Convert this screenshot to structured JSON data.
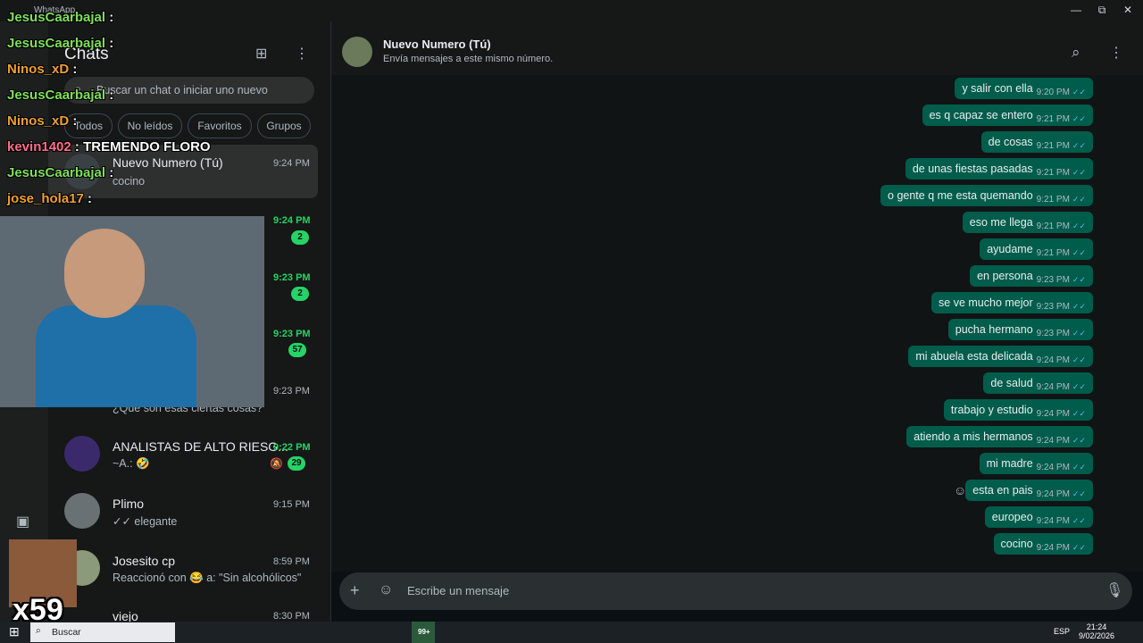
{
  "window": {
    "app_title": "WhatsApp",
    "minimize": "—",
    "restore": "⧉",
    "close": "✕"
  },
  "sidebar": {
    "title": "Chats",
    "search_placeholder": "Buscar un chat o iniciar uno nuevo",
    "filters": [
      "Todos",
      "No leídos",
      "Favoritos",
      "Grupos"
    ],
    "chats": [
      {
        "name": "Nuevo Numero (Tú)",
        "preview": "cocino",
        "time": "9:24 PM",
        "selected": true
      },
      {
        "name": "",
        "preview": "",
        "time": "9:24 PM",
        "badge": "2"
      },
      {
        "name": "",
        "preview": "",
        "time": "9:23 PM",
        "badge": "2"
      },
      {
        "name": "",
        "preview": "",
        "time": "9:23 PM",
        "badge": "57"
      },
      {
        "name": "",
        "preview": "¿Qué son esas ciertas cosas?",
        "time": "9:23 PM"
      },
      {
        "name": "ANALISTAS DE ALTO RIESG...",
        "preview": "~A.: 🤣",
        "time": "9:22 PM",
        "badge": "29"
      },
      {
        "name": "Plimo",
        "preview": "elegante",
        "time": "9:15 PM"
      },
      {
        "name": "Josesito cp",
        "preview": "Reaccionó con 😂 a: \"Sin alcohólicos\"",
        "time": "8:59 PM"
      },
      {
        "name": "viejo",
        "preview": "",
        "time": "8:30 PM"
      }
    ]
  },
  "chat": {
    "name": "Nuevo Numero (Tú)",
    "subtitle": "Envía mensajes a este mismo número.",
    "messages": [
      {
        "text": "y salir con ella",
        "time": "9:20 PM"
      },
      {
        "text": "es q capaz se entero",
        "time": "9:21 PM"
      },
      {
        "text": "de cosas",
        "time": "9:21 PM"
      },
      {
        "text": "de unas fiestas pasadas",
        "time": "9:21 PM"
      },
      {
        "text": "o gente q me esta quemando",
        "time": "9:21 PM"
      },
      {
        "text": "eso me llega",
        "time": "9:21 PM"
      },
      {
        "text": "ayudame",
        "time": "9:21 PM"
      },
      {
        "text": "en persona",
        "time": "9:23 PM"
      },
      {
        "text": "se ve mucho mejor",
        "time": "9:23 PM"
      },
      {
        "text": "pucha hermano",
        "time": "9:23 PM"
      },
      {
        "text": "mi abuela esta delicada",
        "time": "9:24 PM"
      },
      {
        "text": "de salud",
        "time": "9:24 PM"
      },
      {
        "text": "trabajo y estudio",
        "time": "9:24 PM"
      },
      {
        "text": "atiendo a mis hermanos",
        "time": "9:24 PM"
      },
      {
        "text": "mi madre",
        "time": "9:24 PM"
      },
      {
        "text": "esta en pais",
        "time": "9:24 PM"
      },
      {
        "text": "europeo",
        "time": "9:24 PM"
      },
      {
        "text": "cocino",
        "time": "9:24 PM"
      }
    ],
    "composer_placeholder": "Escribe un mensaje"
  },
  "stream_chat": [
    {
      "user": "JesusCaarbajal",
      "text": "",
      "color": "#7ee05a"
    },
    {
      "user": "JesusCaarbajal",
      "text": "",
      "color": "#7ee05a"
    },
    {
      "user": "Ninos_xD",
      "text": "",
      "color": "#f0a030"
    },
    {
      "user": "JesusCaarbajal",
      "text": "",
      "color": "#7ee05a"
    },
    {
      "user": "Ninos_xD",
      "text": "",
      "color": "#f0a030"
    },
    {
      "user": "kevin1402",
      "text": "TREMENDO FLORO",
      "color": "#ff6e8a"
    },
    {
      "user": "JesusCaarbajal",
      "text": "",
      "color": "#7ee05a"
    },
    {
      "user": "jose_hola17",
      "text": "",
      "color": "#f0a030"
    }
  ],
  "overlay": {
    "multiplier": "x59"
  },
  "taskbar": {
    "search": "Buscar",
    "lang": "ESP",
    "time": "21:24",
    "date": "9/02/2026",
    "badge": "99+"
  }
}
